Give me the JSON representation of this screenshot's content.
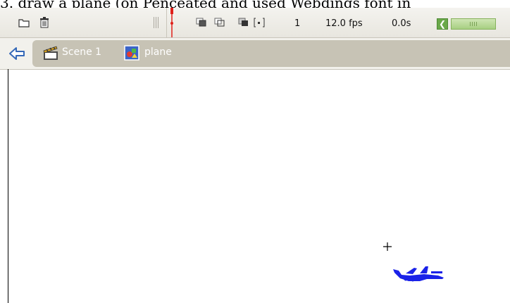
{
  "caption": {
    "text": "3. draw a plane (on Penceated and used Webdings font in"
  },
  "timeline": {
    "current_frame": "1",
    "frame_rate": "12.0 fps",
    "elapsed_time": "0.0s",
    "icons": [
      "folder-icon",
      "trash-icon",
      "onion-skin-icon",
      "onion-outlines-icon",
      "edit-multiple-frames-icon",
      "modify-onion-markers-icon",
      "scroll-left-icon"
    ]
  },
  "edit_bar": {
    "scene_label": "Scene 1",
    "symbol_label": "plane"
  },
  "colors": {
    "plane": "#1a22e8",
    "toolbar_bg": "#ece9e2",
    "breadcrumb_bg": "#c7c3b5",
    "playhead": "#e0201a",
    "scrollbar": "#6aa84a"
  }
}
